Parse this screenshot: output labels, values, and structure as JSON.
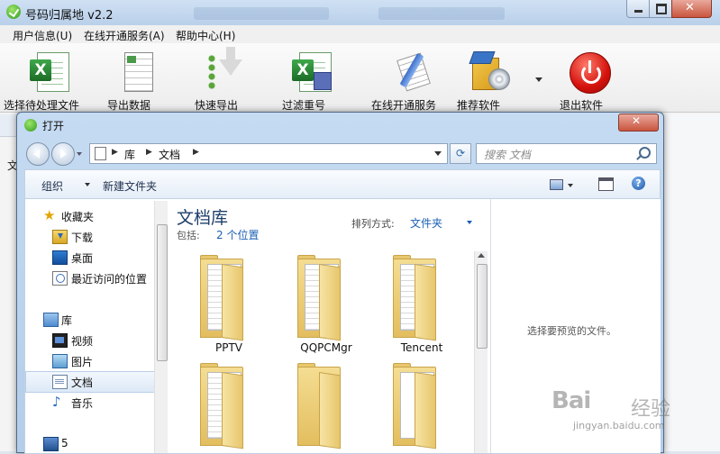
{
  "app": {
    "title": "号码归属地 v2.2",
    "menu": [
      "用户信息(U)",
      "在线开通服务(A)",
      "帮助中心(H)"
    ],
    "toolbar": [
      {
        "label": "选择待处理文件",
        "icon": "excel-icon"
      },
      {
        "label": "导出数据",
        "icon": "spreadsheet-icon"
      },
      {
        "label": "快速导出",
        "icon": "download-arrow-icon"
      },
      {
        "label": "过滤重号",
        "icon": "excel-filter-icon"
      },
      {
        "label": "在线开通服务",
        "icon": "document-pen-icon"
      },
      {
        "label": "推荐软件",
        "icon": "software-box-icon"
      },
      {
        "label": "退出软件",
        "icon": "power-icon"
      }
    ],
    "side_char": "文"
  },
  "dialog": {
    "title": "打开",
    "breadcrumb": [
      "库",
      "文档"
    ],
    "search_placeholder": "搜索 文档",
    "commands": {
      "organize": "组织",
      "new_folder": "新建文件夹"
    },
    "nav": {
      "favorites": {
        "label": "收藏夹",
        "items": [
          "下载",
          "桌面",
          "最近访问的位置"
        ]
      },
      "libraries": {
        "label": "库",
        "items": [
          "视频",
          "图片",
          "文档",
          "音乐"
        ]
      },
      "computer_partial": "5"
    },
    "library": {
      "title": "文档库",
      "includes_label": "包括:",
      "includes_value": "2 个位置",
      "sort_label": "排列方式:",
      "sort_value": "文件夹"
    },
    "folders": [
      "PPTV",
      "QQPCMgr",
      "Tencent",
      "",
      "",
      ""
    ],
    "preview_text": "选择要预览的文件。"
  },
  "watermark": {
    "logo": "Bai",
    "cn": "经验",
    "url": "jingyan.baidu.com"
  },
  "colors": {
    "accent": "#1a5fb4",
    "title_blue": "#1e3f6a",
    "close_red": "#c9553e"
  }
}
